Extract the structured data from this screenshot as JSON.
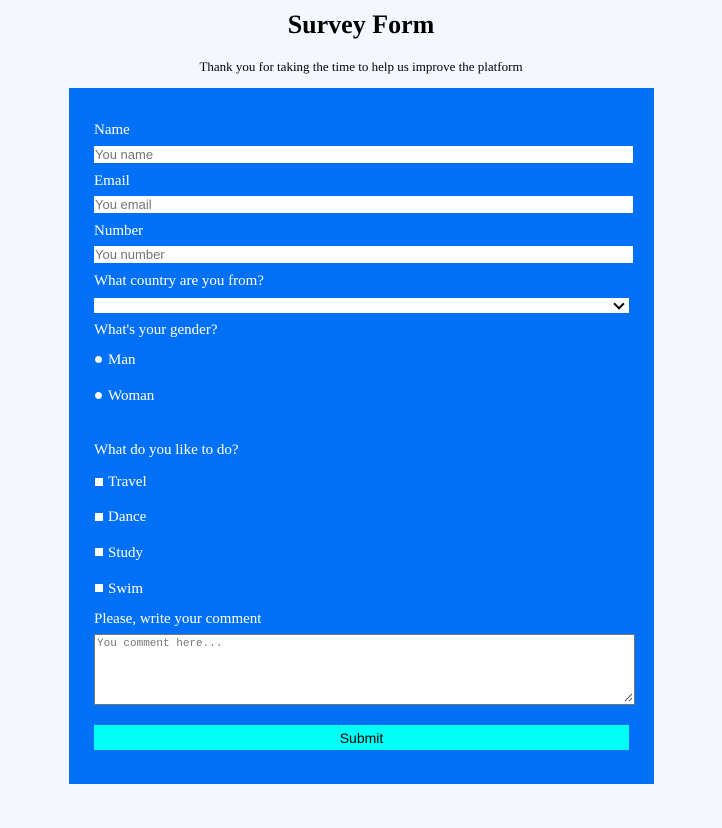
{
  "header": {
    "title": "Survey Form",
    "description": "Thank you for taking the time to help us improve the platform"
  },
  "form": {
    "name": {
      "label": "Name",
      "placeholder": "You name"
    },
    "email": {
      "label": "Email",
      "placeholder": "You email"
    },
    "number": {
      "label": "Number",
      "placeholder": "You number"
    },
    "country": {
      "label": "What country are you from?",
      "selected": "",
      "icon": "chevron-down-icon"
    },
    "gender": {
      "label": "What's your gender?",
      "options": [
        "Man",
        "Woman"
      ]
    },
    "activities": {
      "label": "What do you like to do?",
      "options": [
        "Travel",
        "Dance",
        "Study",
        "Swim"
      ]
    },
    "comment": {
      "label": "Please, write your comment",
      "placeholder": "You comment here..."
    },
    "submit_label": "Submit"
  },
  "colors": {
    "page_background": "#f5f7ff",
    "form_background": "#0070f6",
    "submit_background": "#00fff6",
    "label_text": "#ffffff"
  }
}
